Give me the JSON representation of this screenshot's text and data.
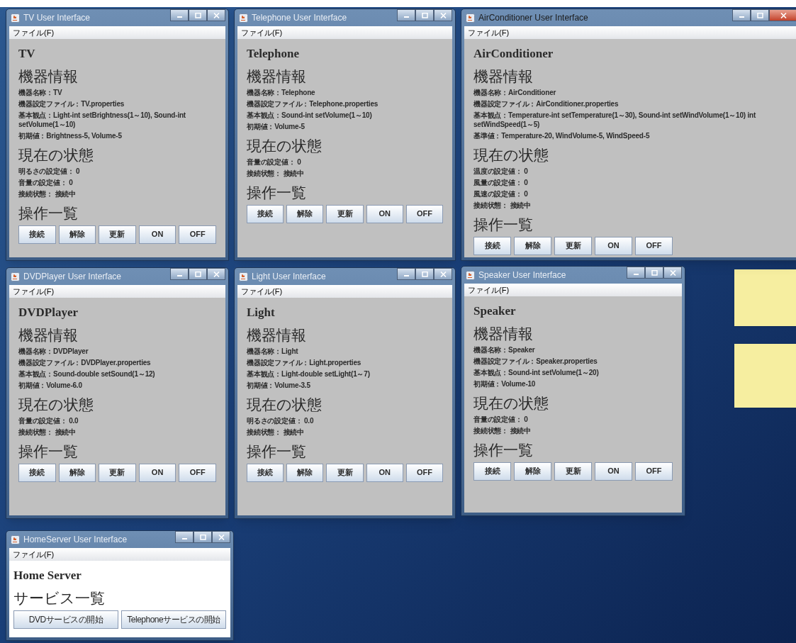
{
  "windows": [
    {
      "title": "TV User Interface",
      "active": false,
      "menu": [
        "ファイル(F)"
      ],
      "kind": "device",
      "heading": "TV",
      "sections": [
        {
          "heading": "機器情報",
          "lines": [
            "機器名称：TV",
            "機器設定ファイル：TV.properties",
            "基本観点：Light-int setBrightness(1～10), Sound-int setVolume(1～10)",
            "初期値：Brightness-5, Volume-5"
          ]
        },
        {
          "heading": "現在の状態",
          "lines": [
            "明るさの設定値： 0",
            "音量の設定値： 0",
            "接続状態： 接続中"
          ]
        },
        {
          "heading": "操作一覧",
          "buttons": [
            "接続",
            "解除",
            "更新",
            "ON",
            "OFF"
          ]
        }
      ]
    },
    {
      "title": "Telephone User Interface",
      "active": false,
      "menu": [
        "ファイル(F)"
      ],
      "kind": "device",
      "heading": "Telephone",
      "sections": [
        {
          "heading": "機器情報",
          "lines": [
            "機器名称：Telephone",
            "機器設定ファイル：Telephone.properties",
            "基本観点：Sound-int setVolume(1～10)",
            "初期値：Volume-5"
          ]
        },
        {
          "heading": "現在の状態",
          "lines": [
            "音量の設定値： 0",
            "接続状態： 接続中"
          ]
        },
        {
          "heading": "操作一覧",
          "buttons": [
            "接続",
            "解除",
            "更新",
            "ON",
            "OFF"
          ]
        }
      ]
    },
    {
      "title": "AirConditioner User Interface",
      "active": true,
      "menu": [
        "ファイル(F)"
      ],
      "kind": "device",
      "heading": "AirConditioner",
      "sections": [
        {
          "heading": "機器情報",
          "lines": [
            "機器名称：AirConditioner",
            "機器設定ファイル：AirConditioner.properties",
            "基本観点：Temperature-int setTemperature(1～30), Sound-int setWindVolume(1～10) int setWindSpeed(1～5)",
            "基準値：Temperature-20, WindVolume-5, WindSpeed-5"
          ]
        },
        {
          "heading": "現在の状態",
          "lines": [
            "温度の設定値： 0",
            "風量の設定値： 0",
            "風速の設定値： 0",
            "接続状態： 接続中"
          ]
        },
        {
          "heading": "操作一覧",
          "buttons": [
            "接続",
            "解除",
            "更新",
            "ON",
            "OFF"
          ]
        }
      ]
    },
    {
      "title": "DVDPlayer User Interface",
      "active": false,
      "menu": [
        "ファイル(F)"
      ],
      "kind": "device",
      "heading": "DVDPlayer",
      "sections": [
        {
          "heading": "機器情報",
          "lines": [
            "機器名称：DVDPlayer",
            "機器設定ファイル：DVDPlayer.properties",
            "基本観点：Sound-double setSound(1～12)",
            "初期値：Volume-6.0"
          ]
        },
        {
          "heading": "現在の状態",
          "lines": [
            "音量の設定値： 0.0",
            "接続状態： 接続中"
          ]
        },
        {
          "heading": "操作一覧",
          "buttons": [
            "接続",
            "解除",
            "更新",
            "ON",
            "OFF"
          ]
        }
      ]
    },
    {
      "title": "Light User Interface",
      "active": false,
      "menu": [
        "ファイル(F)"
      ],
      "kind": "device",
      "heading": "Light",
      "sections": [
        {
          "heading": "機器情報",
          "lines": [
            "機器名称：Light",
            "機器設定ファイル：Light.properties",
            "基本観点：Light-double setLight(1～7)",
            "初期値：Volume-3.5"
          ]
        },
        {
          "heading": "現在の状態",
          "lines": [
            "明るさの設定値： 0.0",
            "接続状態： 接続中"
          ]
        },
        {
          "heading": "操作一覧",
          "buttons": [
            "接続",
            "解除",
            "更新",
            "ON",
            "OFF"
          ]
        }
      ]
    },
    {
      "title": "Speaker User Interface",
      "active": false,
      "menu": [
        "ファイル(F)"
      ],
      "kind": "device",
      "heading": "Speaker",
      "sections": [
        {
          "heading": "機器情報",
          "lines": [
            "機器名称：Speaker",
            "機器設定ファイル：Speaker.properties",
            "基本観点：Sound-int setVolume(1～20)",
            "初期値：Volume-10"
          ]
        },
        {
          "heading": "現在の状態",
          "lines": [
            "音量の設定値： 0",
            "接続状態： 接続中"
          ]
        },
        {
          "heading": "操作一覧",
          "buttons": [
            "接続",
            "解除",
            "更新",
            "ON",
            "OFF"
          ]
        }
      ]
    },
    {
      "title": "HomeServer User Interface",
      "active": false,
      "menu": [
        "ファイル(F)"
      ],
      "kind": "server",
      "heading": "Home Server",
      "sections": [
        {
          "heading": "サービス一覧",
          "buttons": [
            "DVDサービスの開始",
            "Telephoneサービスの開始"
          ]
        }
      ]
    }
  ]
}
